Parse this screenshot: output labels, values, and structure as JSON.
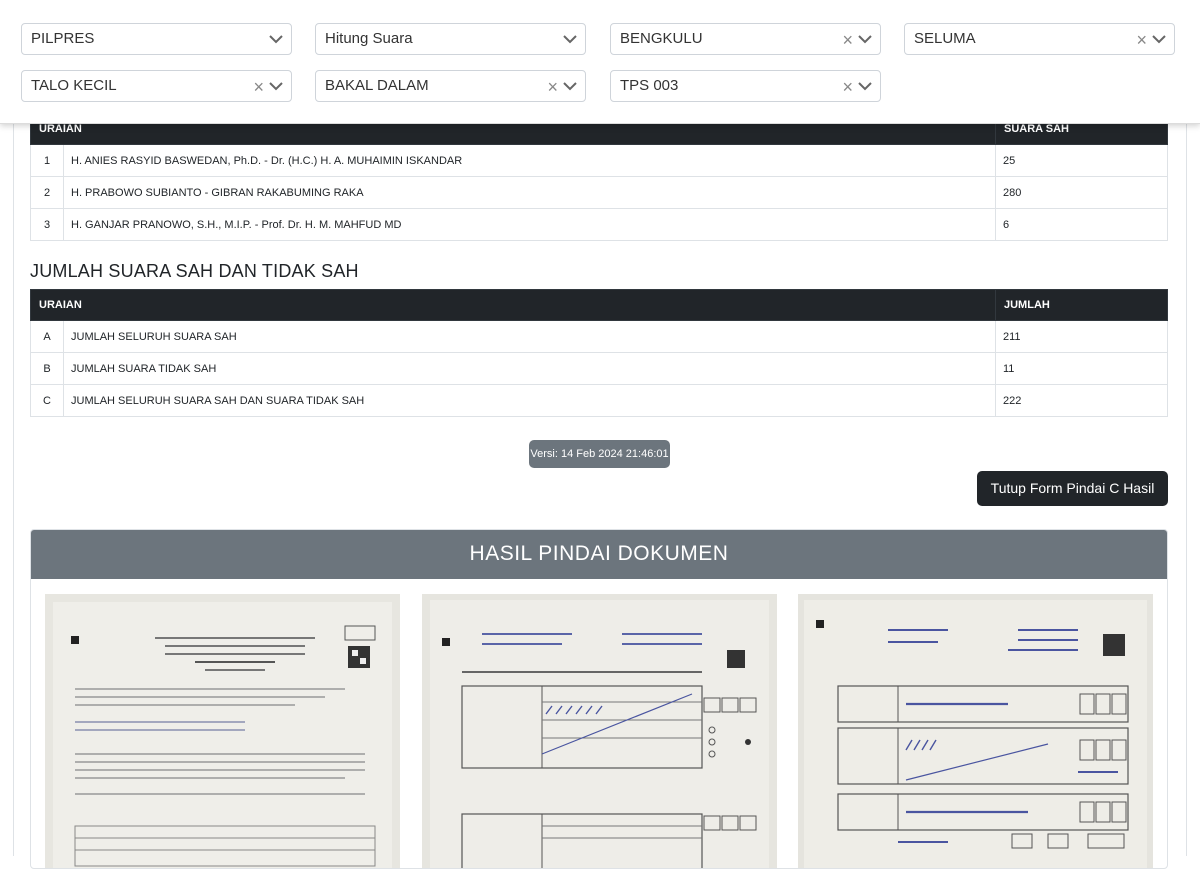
{
  "filters": [
    {
      "value": "PILPRES",
      "clearable": false
    },
    {
      "value": "Hitung Suara",
      "clearable": false
    },
    {
      "value": "BENGKULU",
      "clearable": true
    },
    {
      "value": "SELUMA",
      "clearable": true
    },
    {
      "value": "TALO KECIL",
      "clearable": true
    },
    {
      "value": "BAKAL DALAM",
      "clearable": true
    },
    {
      "value": "TPS 003",
      "clearable": true
    }
  ],
  "icons": {
    "clear": "×",
    "chevron": "chevron-down-icon"
  },
  "candidates_table": {
    "headers": {
      "uraian": "URAIAN",
      "suara": "SUARA SAH"
    },
    "rows": [
      {
        "no": "1",
        "name": "H. ANIES RASYID BASWEDAN, Ph.D. - Dr. (H.C.) H. A. MUHAIMIN ISKANDAR",
        "value": "25"
      },
      {
        "no": "2",
        "name": "H. PRABOWO SUBIANTO - GIBRAN RAKABUMING RAKA",
        "value": "280"
      },
      {
        "no": "3",
        "name": "H. GANJAR PRANOWO, S.H., M.I.P. - Prof. Dr. H. M. MAHFUD MD",
        "value": "6"
      }
    ]
  },
  "totals_section_title": "JUMLAH SUARA SAH DAN TIDAK SAH",
  "totals_table": {
    "headers": {
      "uraian": "URAIAN",
      "jumlah": "JUMLAH"
    },
    "rows": [
      {
        "no": "A",
        "name": "JUMLAH SELURUH SUARA SAH",
        "value": "211"
      },
      {
        "no": "B",
        "name": "JUMLAH SUARA TIDAK SAH",
        "value": "11"
      },
      {
        "no": "C",
        "name": "JUMLAH SELURUH SUARA SAH DAN SUARA TIDAK SAH",
        "value": "222"
      }
    ]
  },
  "version_label": "Versi: 14 Feb 2024 21:46:01",
  "close_button_label": "Tutup Form Pindai C Hasil",
  "scan_section_title": "HASIL PINDAI DOKUMEN",
  "colors": {
    "table_header_bg": "#212529",
    "badge_bg": "#6c757d",
    "scan_header_bg": "#6c757d",
    "button_bg": "#212529"
  }
}
